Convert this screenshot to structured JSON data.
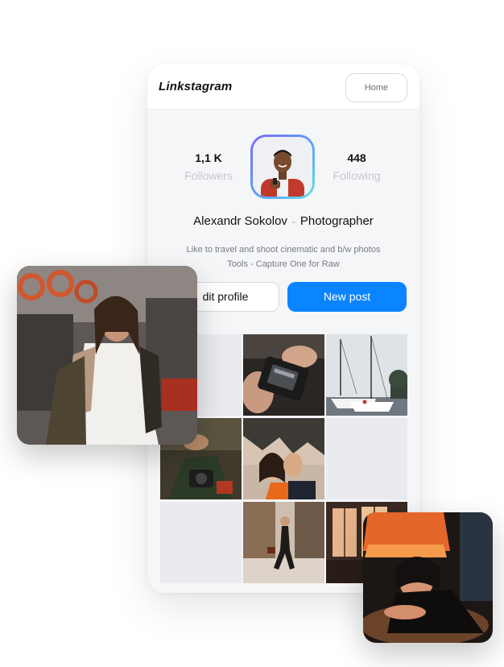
{
  "app": {
    "logo": "Linkstagram",
    "nav_home": "Home"
  },
  "profile": {
    "followers_count": "1,1 K",
    "followers_label": "Followers",
    "following_count": "448",
    "following_label": "Following",
    "name": "Alexandr Sokolov",
    "separator": "-",
    "role": "Photographer",
    "bio_line1": "Like to travel and shoot cinematic and b/w photos",
    "bio_line2": "Tools - Capture One for Raw",
    "edit_button": "dit profile",
    "new_post_button": "New post"
  },
  "colors": {
    "accent": "#0a84ff",
    "avatar_ring_start": "#7b6cf6",
    "avatar_ring_end": "#69e0e8",
    "background": "#f5f6f8"
  },
  "grid_photos": [
    "blank",
    "camera-closeup",
    "sailboats",
    "person-with-camera",
    "couple-selfie",
    "blank",
    "blank",
    "street-walk",
    "window-light"
  ],
  "floating_photos": [
    "backpacker-portrait",
    "lamp-portrait"
  ]
}
